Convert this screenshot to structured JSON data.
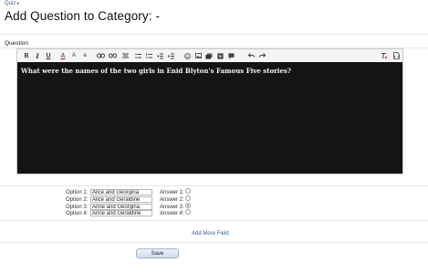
{
  "breadcrumb": {
    "label": "Quiz",
    "arrow": "▸"
  },
  "page_title": "Add Question to Category: -",
  "question_section": {
    "label": "Question"
  },
  "editor": {
    "content": "What were the names of the two girls in Enid Blyton's Famous Five stories?",
    "toolbar_icons": [
      "bold-icon",
      "italic-icon",
      "underline-icon",
      "text-color-icon",
      "text-size-up-icon",
      "text-size-down-icon",
      "link-icon",
      "unlink-icon",
      "align-icon",
      "bulleted-list-icon",
      "numbered-list-icon",
      "outdent-icon",
      "indent-icon",
      "smiley-icon",
      "image-icon",
      "gallery-icon",
      "media-icon",
      "quote-icon",
      "undo-icon",
      "redo-icon",
      "clear-formatting-icon",
      "source-mode-icon"
    ],
    "toolbar_labels": {
      "bold": "B",
      "italic": "I",
      "underline": "U",
      "text_color": "A",
      "size_up": "A",
      "size_down": "a"
    }
  },
  "options": [
    {
      "label": "Option 1:",
      "value": "Alice and Georgina",
      "answer_label": "Answer 1:",
      "selected": false
    },
    {
      "label": "Option 2:",
      "value": "Alice and Geraldine",
      "answer_label": "Answer 2:",
      "selected": false
    },
    {
      "label": "Option 3:",
      "value": "Anne and Georgina",
      "answer_label": "Answer 3:",
      "selected": true
    },
    {
      "label": "Option 4:",
      "value": "Anne and Geraldine",
      "answer_label": "Answer 4:",
      "selected": false
    }
  ],
  "add_more_label": "Add More Field",
  "save_label": "Save",
  "colors": {
    "editor_bg": "#141414",
    "link": "#2f5f9a",
    "radio_checked": "#2c6fc9"
  }
}
